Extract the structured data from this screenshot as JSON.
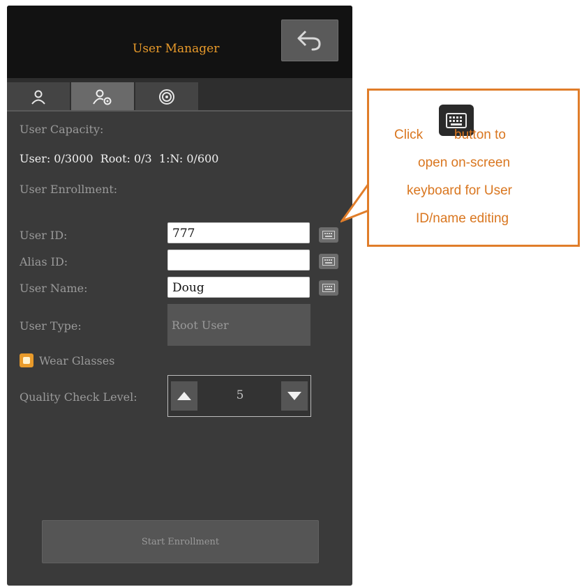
{
  "header": {
    "title": "User Manager"
  },
  "tabs": [
    {
      "name": "user-tab",
      "icon": "person-icon",
      "active": false
    },
    {
      "name": "user-settings-tab",
      "icon": "person-gear-icon",
      "active": true
    },
    {
      "name": "settings-tab",
      "icon": "gear-icon",
      "active": false
    }
  ],
  "capacity": {
    "label": "User Capacity:",
    "value": "User: 0/3000  Root: 0/3  1:N: 0/600"
  },
  "enrollment_label": "User Enrollment:",
  "fields": {
    "user_id": {
      "label": "User ID:",
      "value": "777"
    },
    "alias_id": {
      "label": "Alias ID:",
      "value": ""
    },
    "user_name": {
      "label": "User Name:",
      "value": "Doug"
    }
  },
  "user_type": {
    "label": "User Type:",
    "value": "Root User"
  },
  "wear_glasses": {
    "label": "Wear Glasses",
    "checked": true
  },
  "quality": {
    "label": "Quality Check Level:",
    "value": "5"
  },
  "start_button": "Start Enrollment",
  "callout": {
    "lines": [
      "Click",
      "button to",
      "open on-screen",
      "keyboard for User",
      "ID/name editing"
    ]
  },
  "colors": {
    "accent": "#e89a2a",
    "callout": "#e07d2a",
    "panel": "#3a3a3a",
    "header": "#121212"
  }
}
